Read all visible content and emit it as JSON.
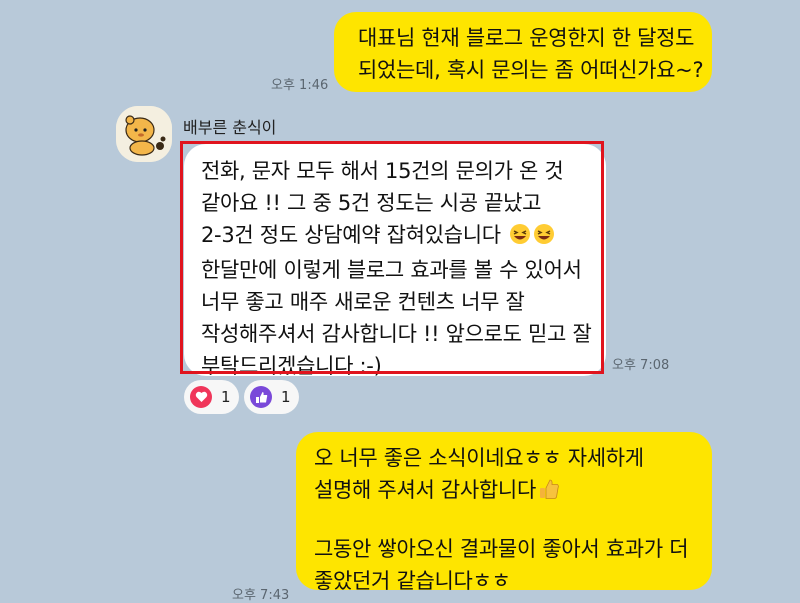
{
  "messages": {
    "q1": {
      "lines": [
        "대표님 현재 블로그 운영한지 한 달정도",
        "되었는데, 혹시 문의는 좀 어떠신가요~?"
      ],
      "time": "오후 1:46"
    },
    "reply": {
      "sender": "배부른 춘식이",
      "lines": [
        "전화, 문자 모두 해서 15건의 문의가 온 것",
        "같아요 !! 그 중 5건 정도는 시공 끝났고",
        "2-3건 정도 상담예약 잡혀있습니다",
        "한달만에 이렇게 블로그 효과를 볼 수 있어서",
        "너무 좋고 매주 새로운 컨텐츠 너무 잘",
        "작성해주셔서 감사합니다 !! 앞으로도 믿고 잘",
        "부탁드리겠습니다 :-)"
      ],
      "emoji": "laughing-emoji",
      "time": "오후 7:08",
      "reactions": [
        {
          "icon": "heart-icon",
          "count": "1",
          "color": "#f0365a"
        },
        {
          "icon": "thumbs-up-icon",
          "count": "1",
          "color": "#7a49d9"
        }
      ]
    },
    "a1": {
      "lines": [
        "오 너무 좋은 소식이네요ㅎㅎ 자세하게",
        "설명해 주셔서 감사합니다",
        "그동안 쌓아오신 결과물이 좋아서 효과가 더",
        "좋았던거 같습니다ㅎㅎ"
      ],
      "emoji": "thumbs-up-emoji",
      "time": "오후 7:43"
    }
  },
  "colors": {
    "background": "#b8c9d9",
    "my_bubble": "#fee500",
    "their_bubble": "#ffffff",
    "highlight": "#e0141e"
  }
}
